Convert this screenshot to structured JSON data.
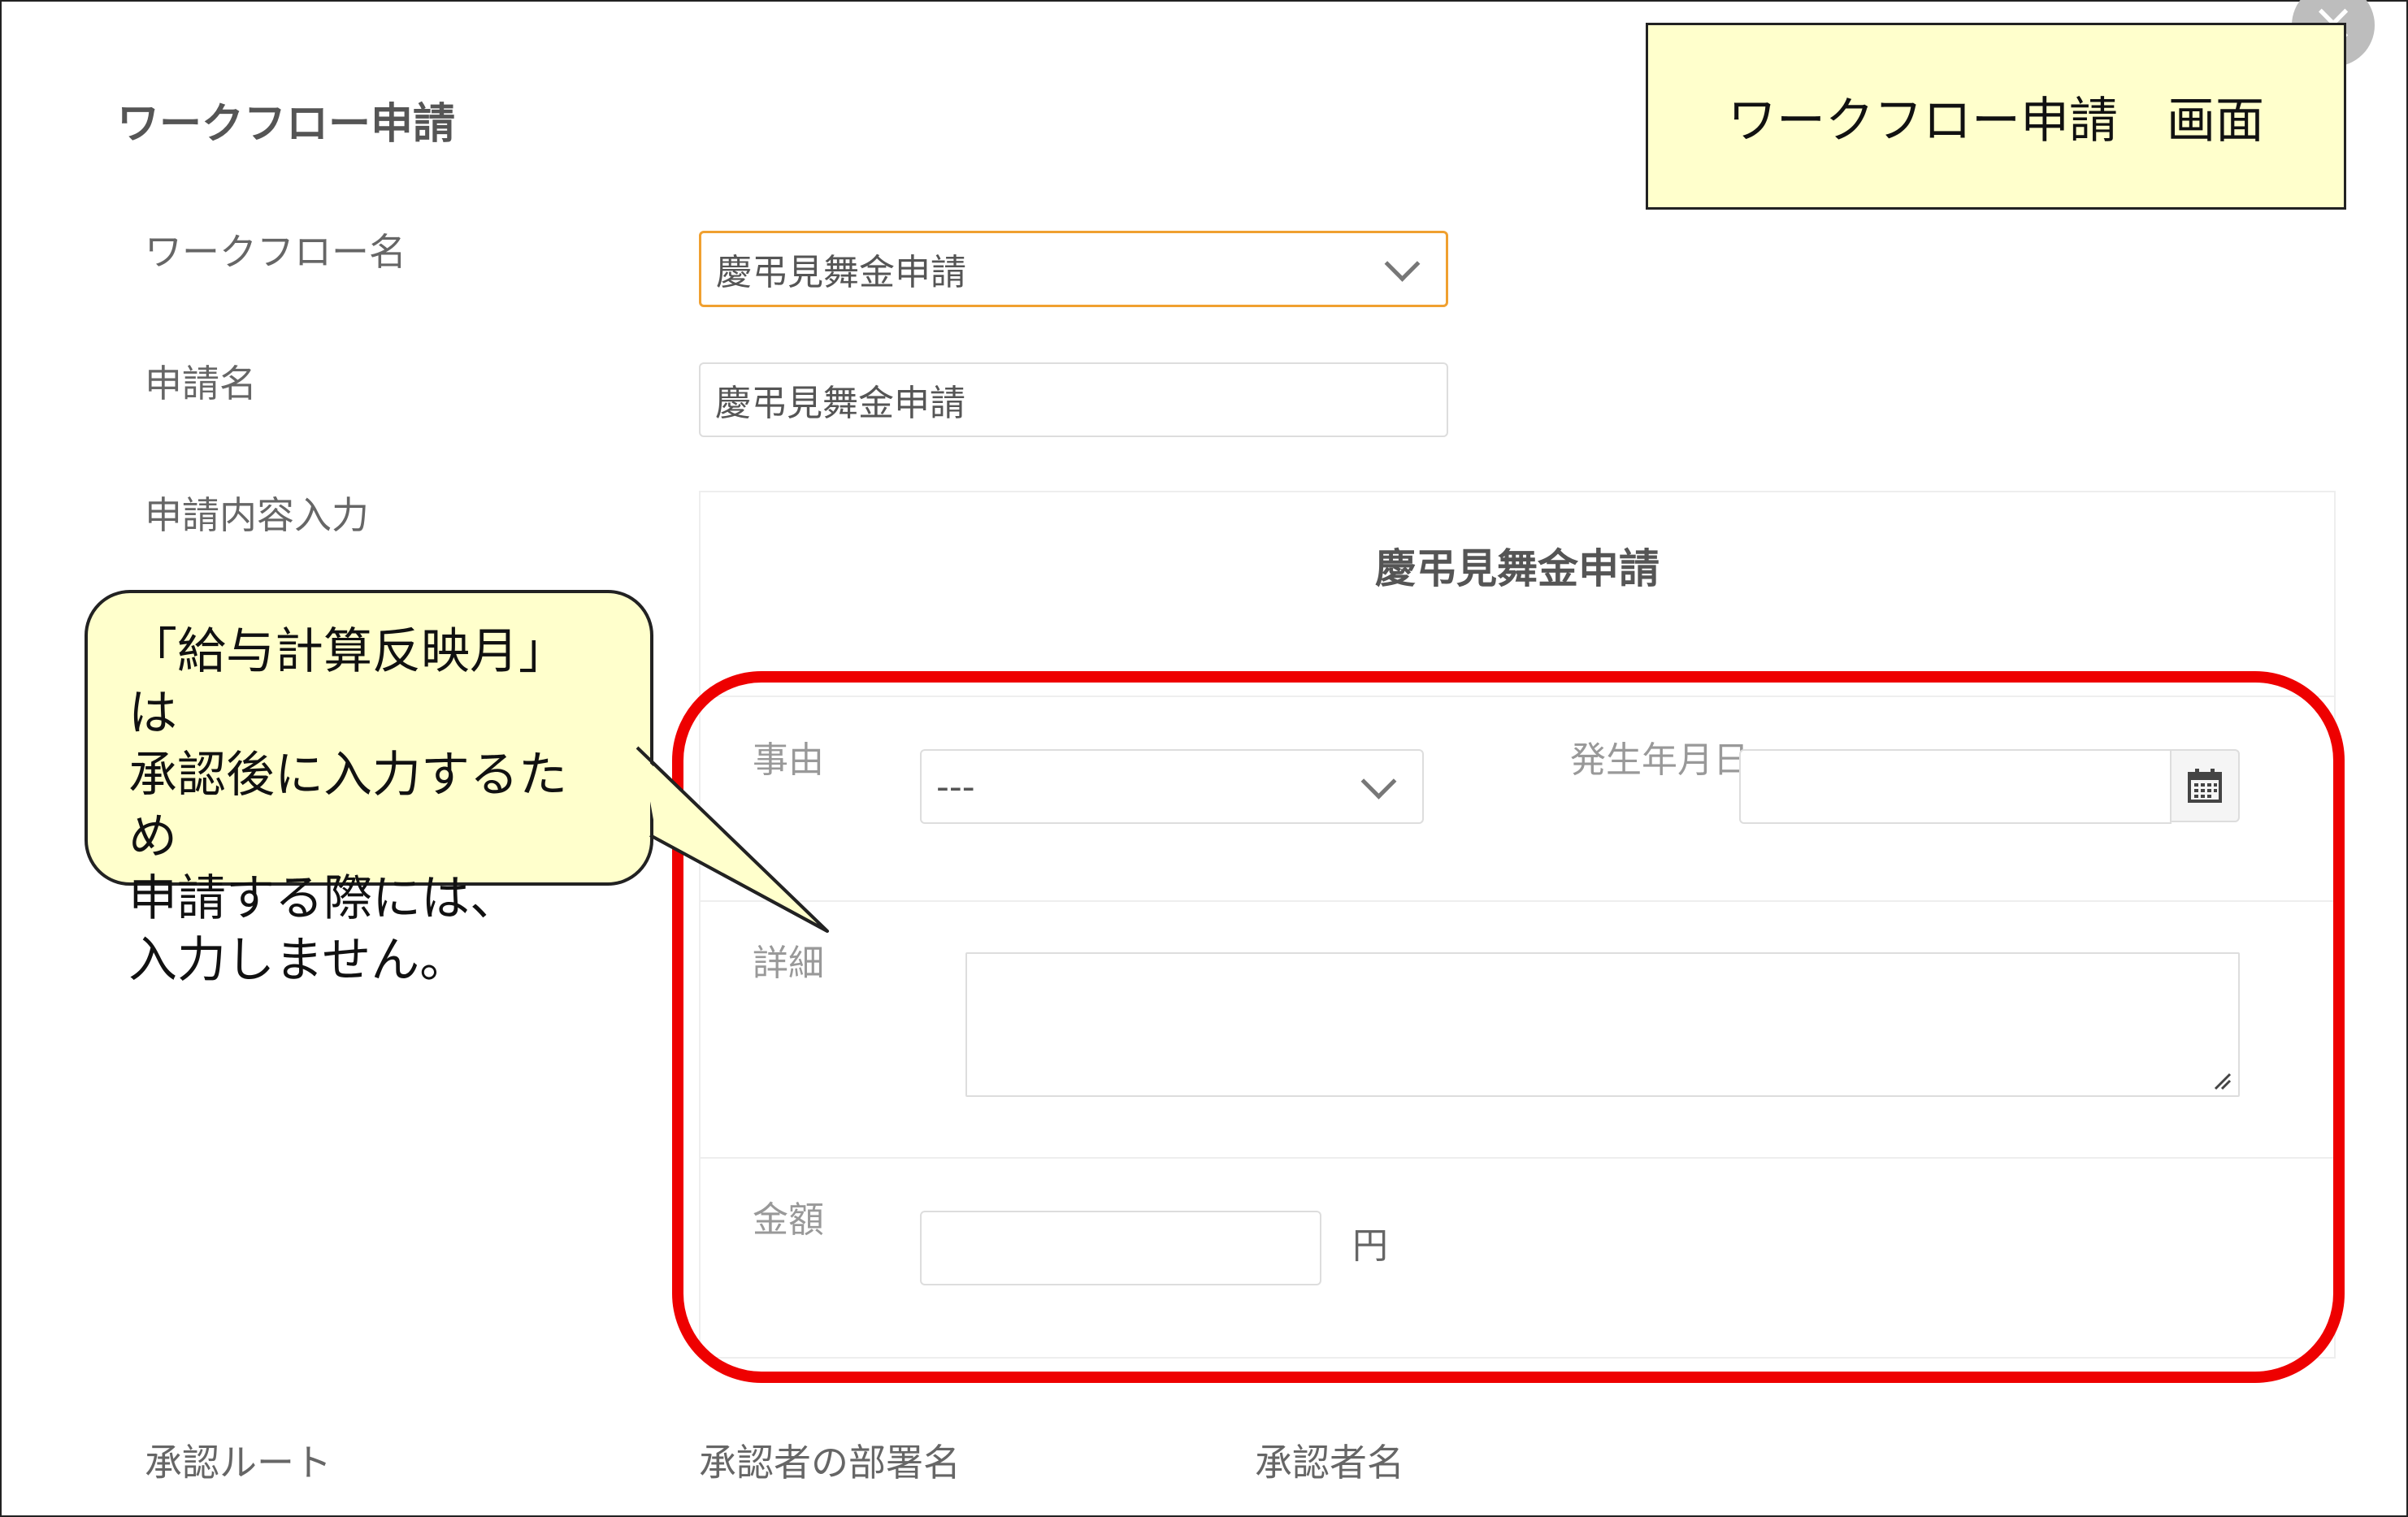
{
  "dialog": {
    "title": "ワークフロー申請",
    "close_label": "×"
  },
  "fields": {
    "workflow_name_label": "ワークフロー名",
    "workflow_name_value": "慶弔見舞金申請",
    "application_name_label": "申請名",
    "application_name_value": "慶弔見舞金申請",
    "content_label": "申請内容入力"
  },
  "form": {
    "title": "慶弔見舞金申請",
    "reason_label": "事由",
    "reason_value": "---",
    "date_label": "発生年月日",
    "date_value": "",
    "detail_label": "詳細",
    "detail_value": "",
    "amount_label": "金額",
    "amount_value": "",
    "amount_unit": "円"
  },
  "approval": {
    "route_label": "承認ルート",
    "department_header": "承認者の部署名",
    "approver_header": "承認者名"
  },
  "annotations": {
    "screen_note": "ワークフロー申請　画面",
    "callout_lines": [
      "「給与計算反映月」は",
      "承認後に入力するため",
      "申請する際には、",
      "入力しません。"
    ],
    "highlight_color": "#ee0000",
    "note_color": "#ffffcc"
  }
}
